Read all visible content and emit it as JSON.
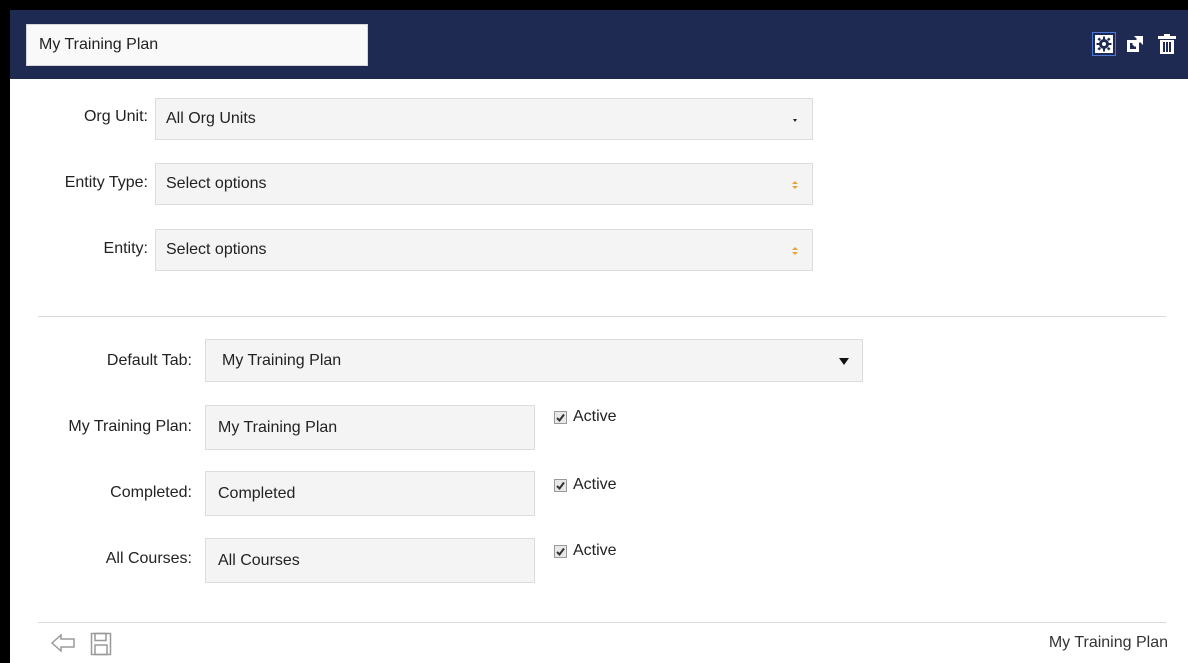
{
  "header": {
    "title_value": "My Training Plan",
    "icons": [
      "settings-icon",
      "popout-icon",
      "trash-icon"
    ]
  },
  "filters": {
    "org_unit": {
      "label": "Org Unit:",
      "value": "All Org Units"
    },
    "entity_type": {
      "label": "Entity Type:",
      "value": "Select options"
    },
    "entity": {
      "label": "Entity:",
      "value": "Select options"
    }
  },
  "tabs_config": {
    "default_tab": {
      "label": "Default Tab:",
      "value": "My Training Plan"
    },
    "rows": [
      {
        "label": "My Training Plan:",
        "value": "My Training Plan",
        "active_label": "Active",
        "active": true
      },
      {
        "label": "Completed:",
        "value": "Completed",
        "active_label": "Active",
        "active": true
      },
      {
        "label": "All Courses:",
        "value": "All Courses",
        "active_label": "Active",
        "active": true
      }
    ]
  },
  "footer": {
    "title": "My Training Plan",
    "icons": [
      "back-arrow-icon",
      "save-icon"
    ]
  },
  "colors": {
    "header_bg": "#1f2a52",
    "accent_orange": "#e8a33a",
    "field_bg": "#f4f4f4"
  }
}
